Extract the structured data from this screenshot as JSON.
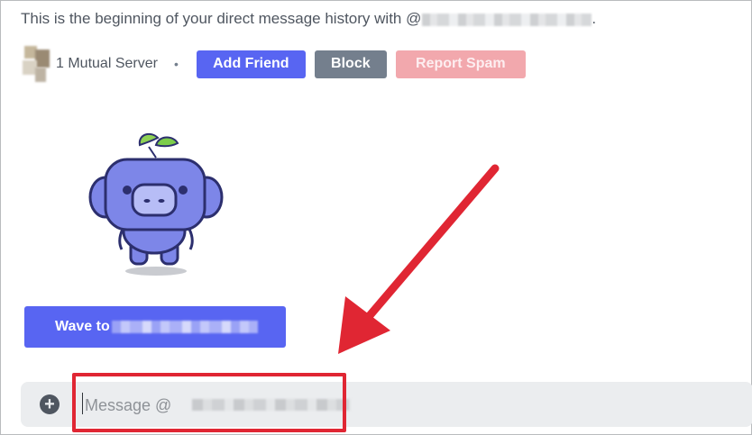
{
  "history": {
    "text": "This is the beginning of your direct message history with @",
    "trailing": "."
  },
  "meta": {
    "mutual_servers": "1 Mutual Server",
    "separator": "•",
    "add_friend_label": "Add Friend",
    "block_label": "Block",
    "report_spam_label": "Report Spam"
  },
  "wave": {
    "label": "Wave to"
  },
  "composer": {
    "placeholder": "Message @"
  },
  "colors": {
    "blurple": "#5865f2",
    "block_gray": "#747f8d",
    "spam_pink": "#f2a8ad",
    "annotation_red": "#e02633",
    "composer_bg": "#ebedef"
  },
  "icons": {
    "attach": "plus-circle-icon",
    "sticker": "wumpus-sticker",
    "annotation": "red-arrow"
  }
}
